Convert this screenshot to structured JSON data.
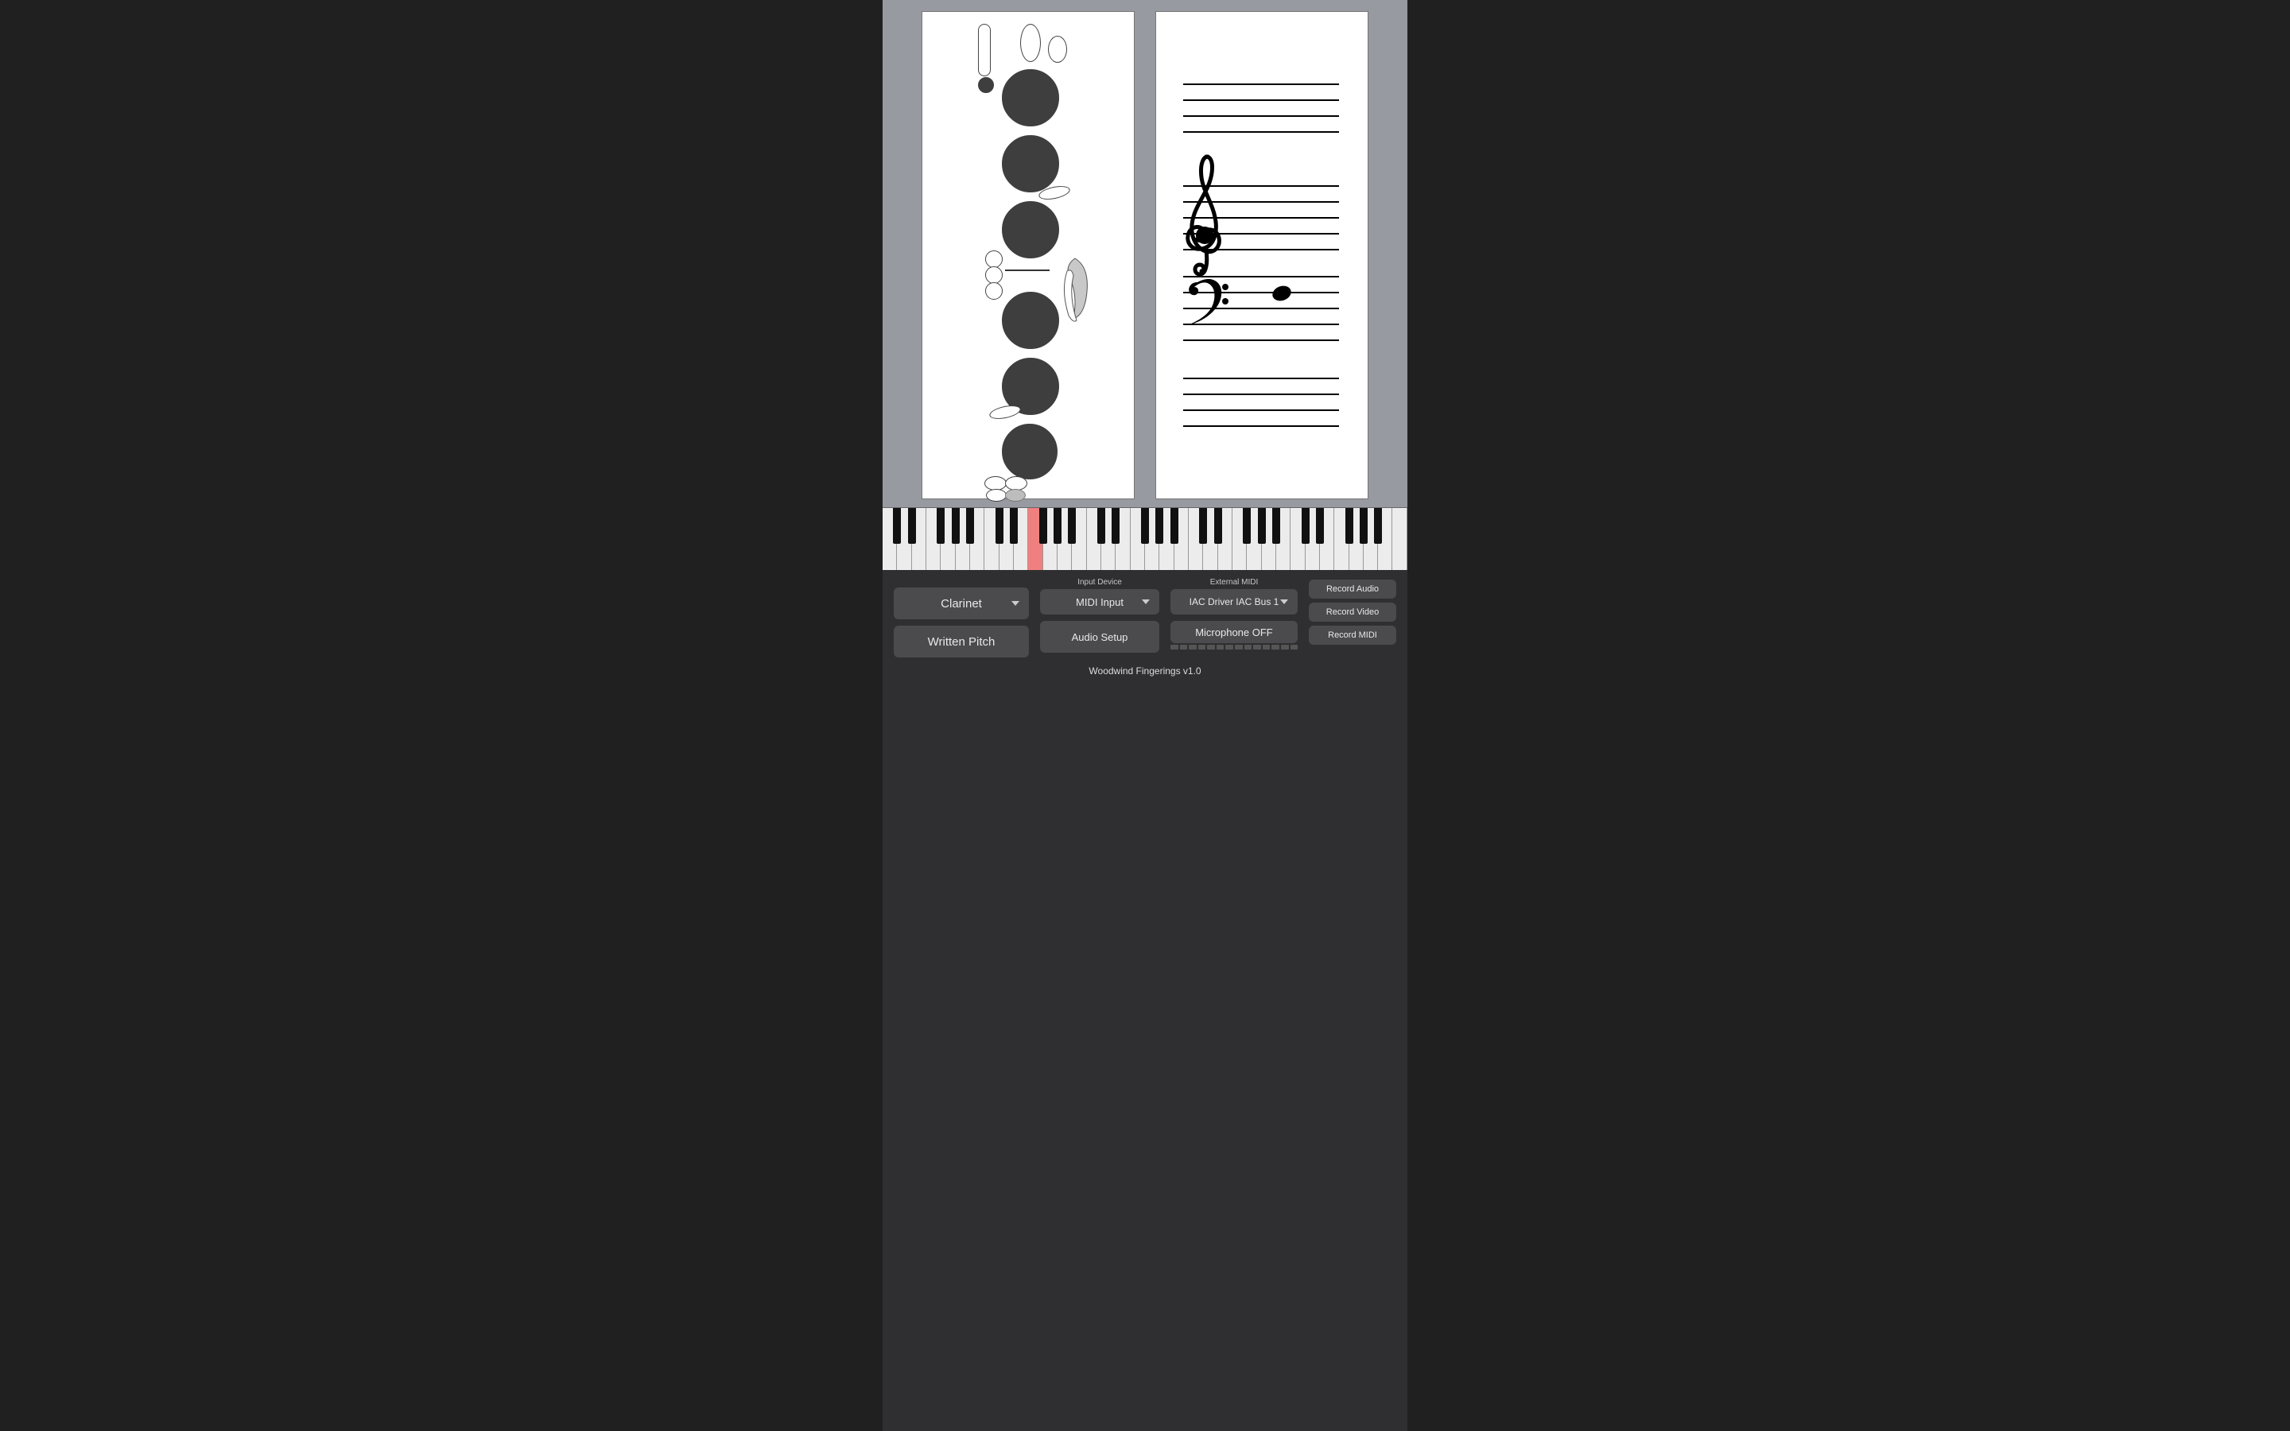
{
  "instrument_select": {
    "value": "Clarinet"
  },
  "written_pitch_button": "Written Pitch",
  "input_device": {
    "label": "Input Device",
    "value": "MIDI Input"
  },
  "external_midi": {
    "label": "External MIDI",
    "value": "IAC Driver IAC Bus 1"
  },
  "audio_setup_button": "Audio Setup",
  "microphone_button": "Microphone OFF",
  "record_audio_button": "Record Audio",
  "record_video_button": "Record Video",
  "record_midi_button": "Record MIDI",
  "footer_text": "Woodwind Fingerings v1.0",
  "fingering": {
    "holes_filled": [
      true,
      true,
      true,
      true,
      true,
      true
    ],
    "register_key_filled": true
  },
  "notation": {
    "clef_top": "treble",
    "clef_bottom": "bass"
  },
  "keyboard": {
    "highlighted_white_key_index": 10,
    "total_white_keys": 36
  }
}
